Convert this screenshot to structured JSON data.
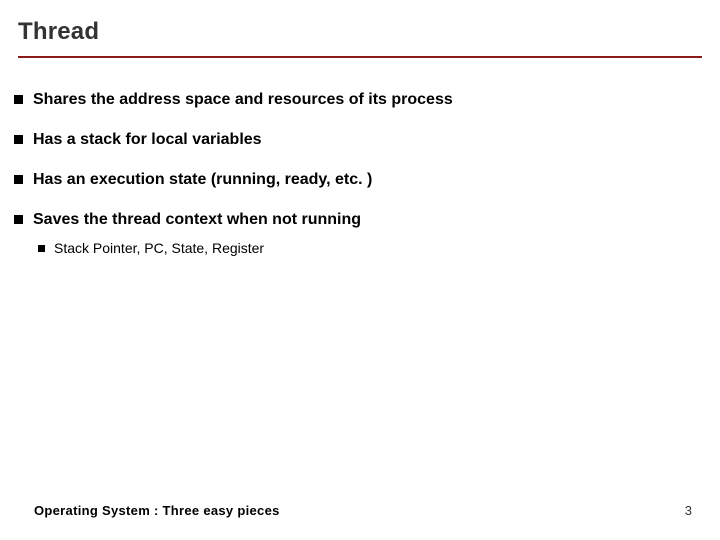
{
  "title": "Thread",
  "bullets": [
    {
      "text": "Shares the address space and resources of its process"
    },
    {
      "text": "Has a stack for local variables"
    },
    {
      "text": "Has an execution state (running, ready, etc. )"
    },
    {
      "text": "Saves the thread context when not running",
      "sub": [
        {
          "text": "Stack Pointer, PC, State, Register"
        }
      ]
    }
  ],
  "footer": {
    "left": "Operating System : Three easy pieces",
    "page": "3"
  }
}
